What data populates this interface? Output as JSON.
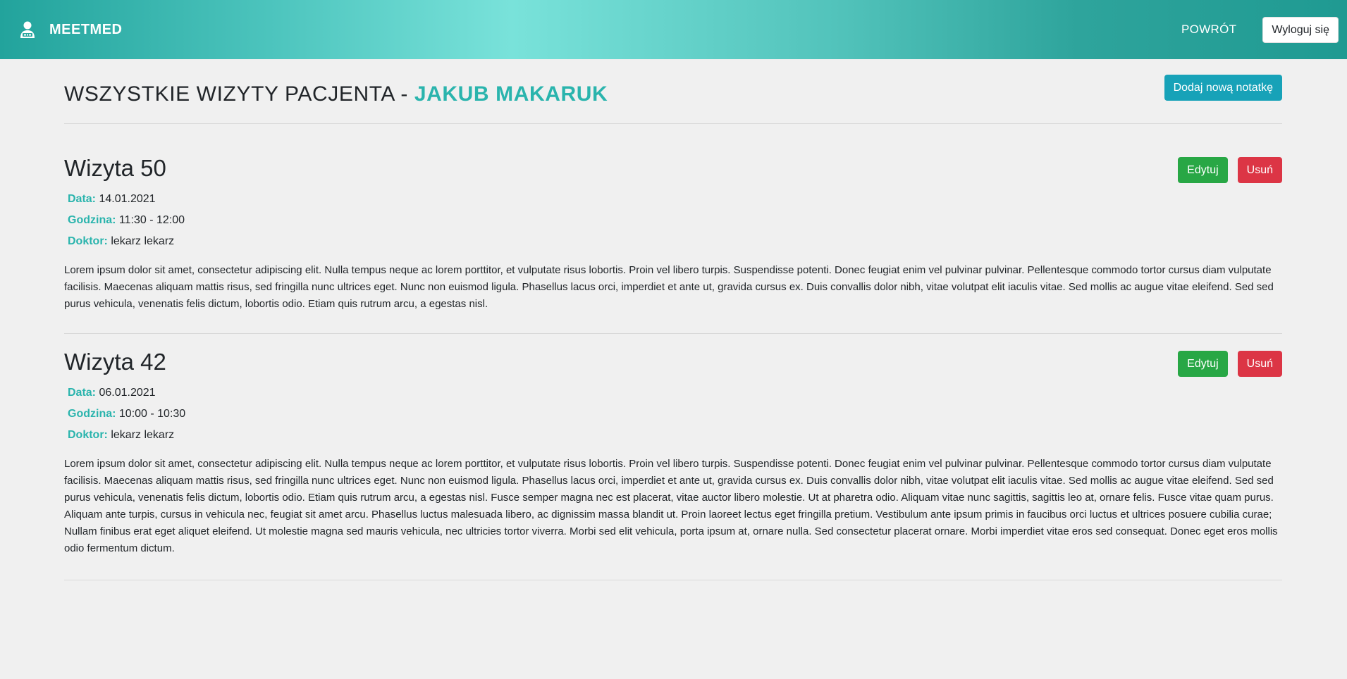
{
  "navbar": {
    "brand_icon": "doctor-user-icon",
    "brand_name": "MEETMED",
    "back_label": "POWRÓT",
    "logout_label": "Wyloguj się"
  },
  "header": {
    "title_prefix": "WSZYSTKIE WIZYTY PACJENTA - ",
    "patient_name": "JAKUB MAKARUK",
    "add_note_label": "Dodaj nową notatkę"
  },
  "labels": {
    "date": "Data:",
    "time": "Godzina:",
    "doctor": "Doktor:",
    "edit": "Edytuj",
    "delete": "Usuń"
  },
  "visits": [
    {
      "title": "Wizyta 50",
      "date": "14.01.2021",
      "time": "11:30 - 12:00",
      "doctor": "lekarz lekarz",
      "text": "Lorem ipsum dolor sit amet, consectetur adipiscing elit. Nulla tempus neque ac lorem porttitor, et vulputate risus lobortis. Proin vel libero turpis. Suspendisse potenti. Donec feugiat enim vel pulvinar pulvinar. Pellentesque commodo tortor cursus diam vulputate facilisis. Maecenas aliquam mattis risus, sed fringilla nunc ultrices eget. Nunc non euismod ligula. Phasellus lacus orci, imperdiet et ante ut, gravida cursus ex. Duis convallis dolor nibh, vitae volutpat elit iaculis vitae. Sed mollis ac augue vitae eleifend. Sed sed purus vehicula, venenatis felis dictum, lobortis odio. Etiam quis rutrum arcu, a egestas nisl."
    },
    {
      "title": "Wizyta 42",
      "date": "06.01.2021",
      "time": "10:00 - 10:30",
      "doctor": "lekarz lekarz",
      "text": "Lorem ipsum dolor sit amet, consectetur adipiscing elit. Nulla tempus neque ac lorem porttitor, et vulputate risus lobortis. Proin vel libero turpis. Suspendisse potenti. Donec feugiat enim vel pulvinar pulvinar. Pellentesque commodo tortor cursus diam vulputate facilisis. Maecenas aliquam mattis risus, sed fringilla nunc ultrices eget. Nunc non euismod ligula. Phasellus lacus orci, imperdiet et ante ut, gravida cursus ex. Duis convallis dolor nibh, vitae volutpat elit iaculis vitae. Sed mollis ac augue vitae eleifend. Sed sed purus vehicula, venenatis felis dictum, lobortis odio. Etiam quis rutrum arcu, a egestas nisl. Fusce semper magna nec est placerat, vitae auctor libero molestie. Ut at pharetra odio. Aliquam vitae nunc sagittis, sagittis leo at, ornare felis. Fusce vitae quam purus. Aliquam ante turpis, cursus in vehicula nec, feugiat sit amet arcu. Phasellus luctus malesuada libero, ac dignissim massa blandit ut. Proin laoreet lectus eget fringilla pretium. Vestibulum ante ipsum primis in faucibus orci luctus et ultrices posuere cubilia curae; Nullam finibus erat eget aliquet eleifend. Ut molestie magna sed mauris vehicula, nec ultricies tortor viverra. Morbi sed elit vehicula, porta ipsum at, ornare nulla. Sed consectetur placerat ornare. Morbi imperdiet vitae eros sed consequat. Donec eget eros mollis odio fermentum dictum."
    }
  ],
  "colors": {
    "accent": "#2ab4ad",
    "info": "#17a2b8",
    "success": "#28a745",
    "danger": "#dc3545",
    "background": "#f0f0f0"
  }
}
